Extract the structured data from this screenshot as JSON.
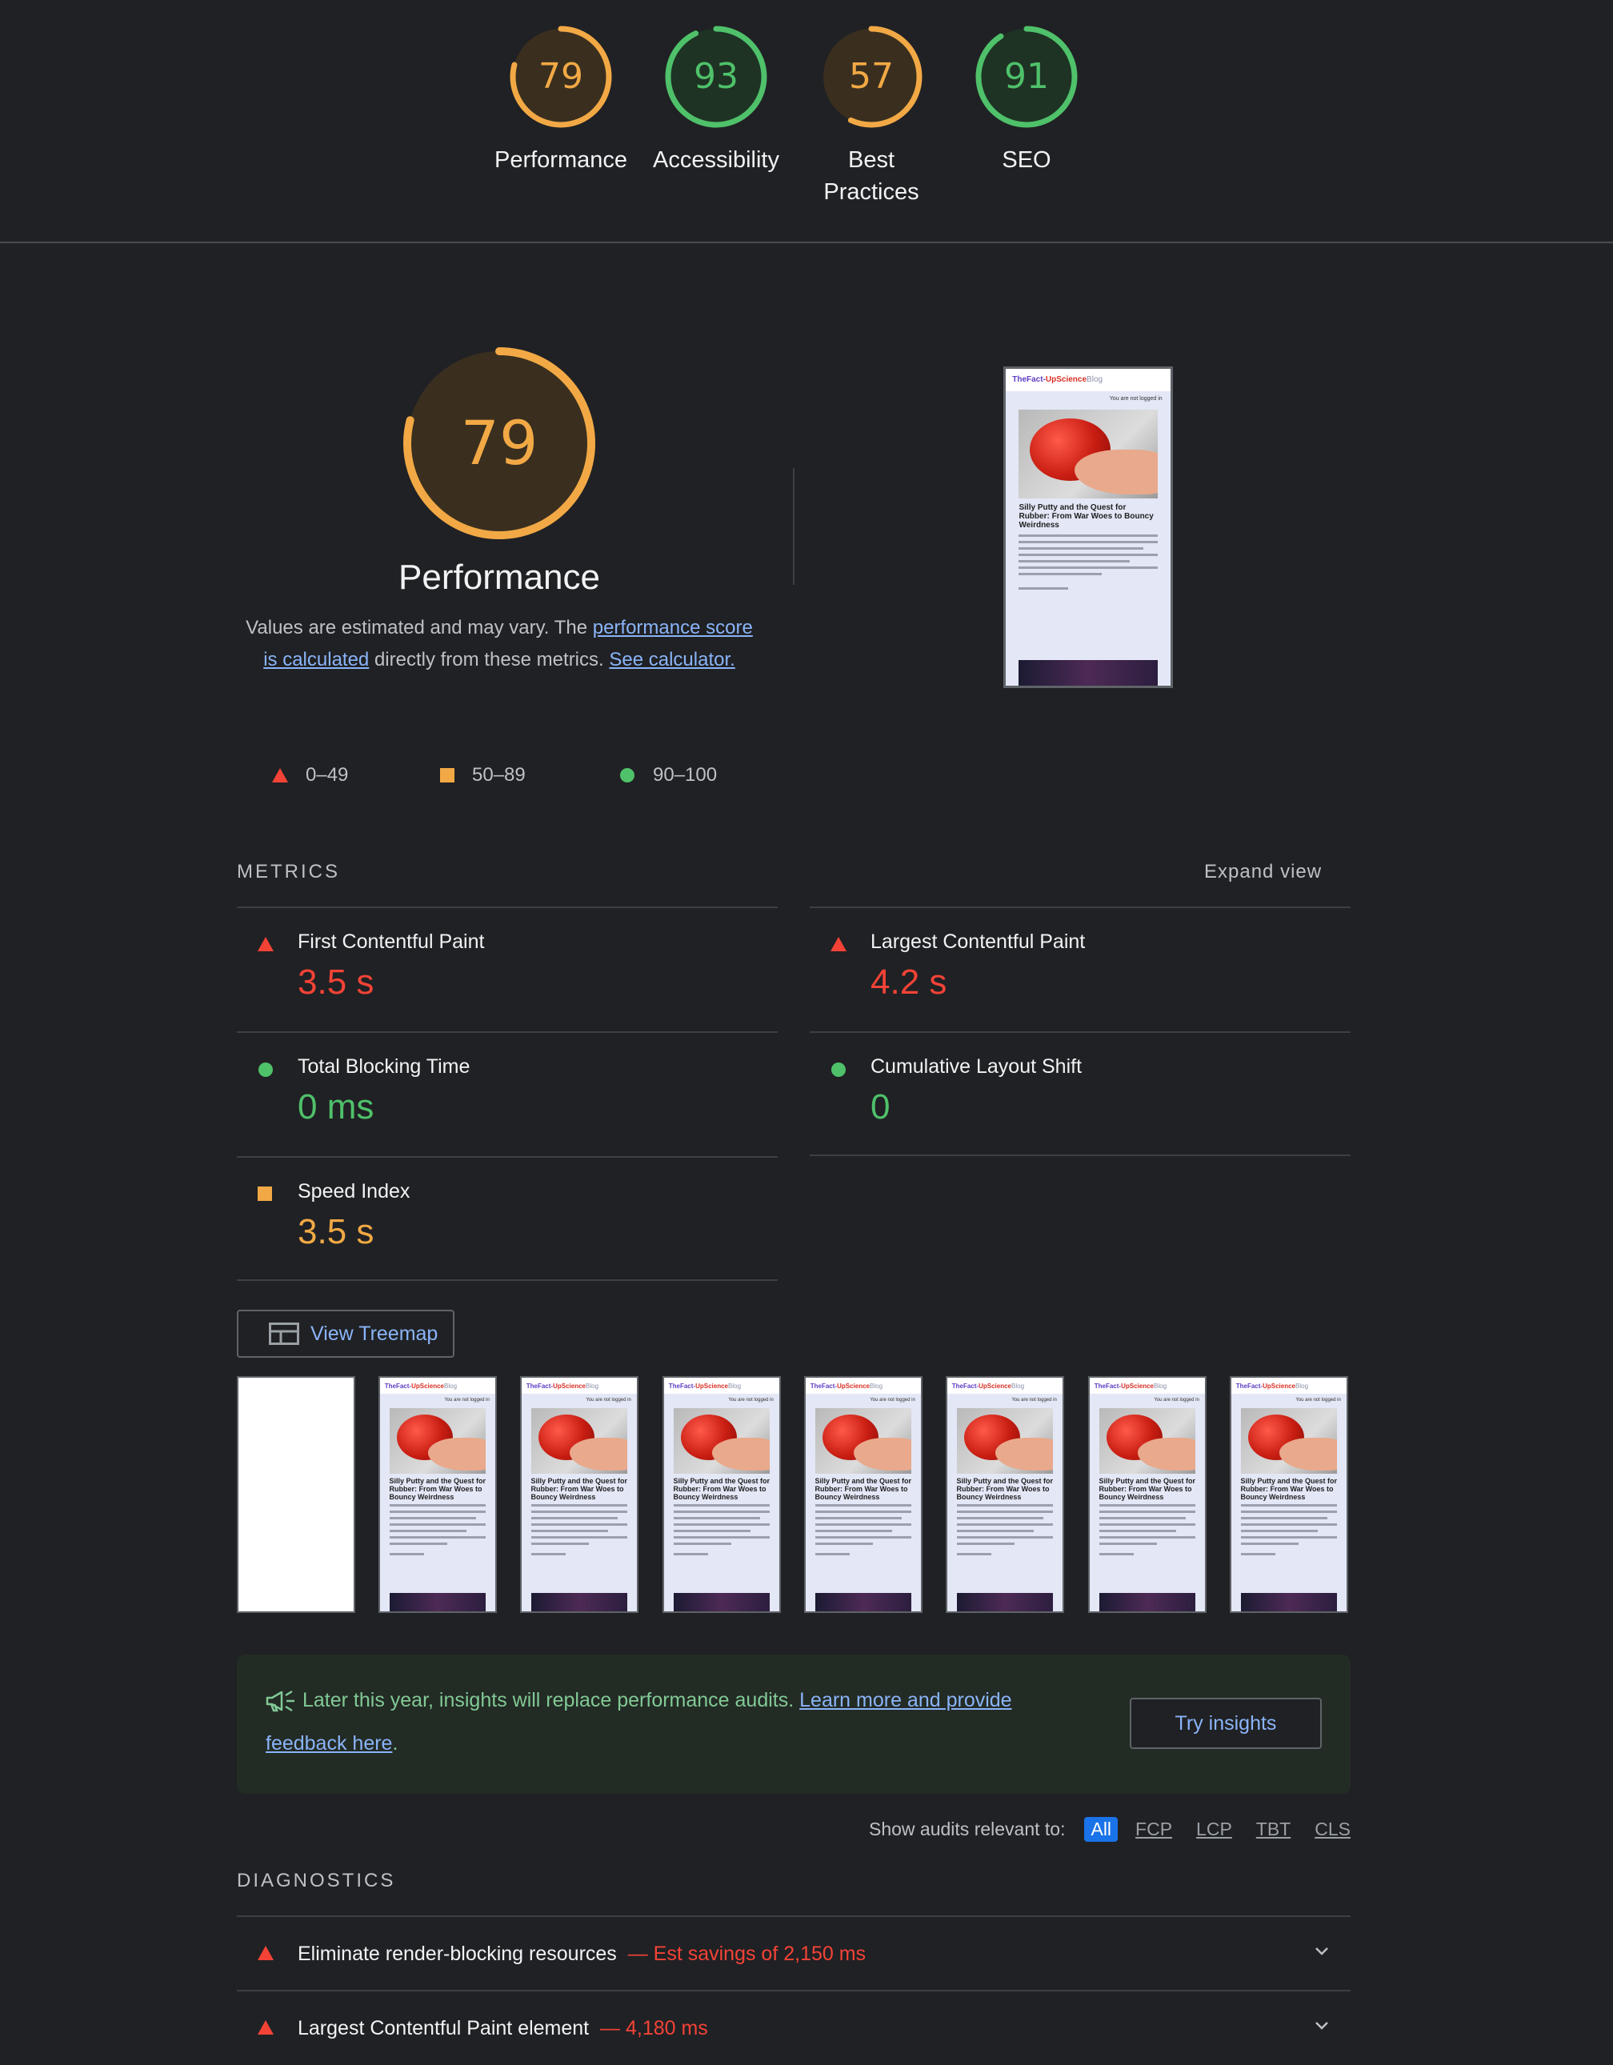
{
  "gauges": [
    {
      "score": "79",
      "label": "Performance",
      "color": "#f2a945",
      "fraction": 0.79
    },
    {
      "score": "93",
      "label": "Accessibility",
      "color": "#4fc16a",
      "fraction": 0.93
    },
    {
      "score": "57",
      "label": "Best Practices",
      "color": "#f2a945",
      "fraction": 0.57
    },
    {
      "score": "91",
      "label": "SEO",
      "color": "#4fc16a",
      "fraction": 0.91
    }
  ],
  "performance": {
    "score": "79",
    "fraction": 0.79,
    "title": "Performance",
    "desc_prefix": "Values are estimated and may vary. The ",
    "desc_link": "performance score is calculated",
    "desc_middle": " directly from these metrics. ",
    "desc_link2": "See calculator.",
    "legend": [
      {
        "range": "0–49",
        "shape": "triangle",
        "color": "#f44336"
      },
      {
        "range": "50–89",
        "shape": "square",
        "color": "#f2a945"
      },
      {
        "range": "90–100",
        "shape": "circle",
        "color": "#4fc16a"
      }
    ]
  },
  "screenshot": {
    "brand1": "TheFact-",
    "brand2": "UpScience",
    "brand3": "Blog",
    "not_logged": "You are not logged in",
    "post_title": "Silly Putty and the Quest for Rubber: From War Woes to Bouncy Weirdness"
  },
  "metrics": {
    "header": "METRICS",
    "expand": "Expand view",
    "items": [
      {
        "name": "First Contentful Paint",
        "value": "3.5 s",
        "status": "fail"
      },
      {
        "name": "Largest Contentful Paint",
        "value": "4.2 s",
        "status": "fail"
      },
      {
        "name": "Total Blocking Time",
        "value": "0 ms",
        "status": "pass"
      },
      {
        "name": "Cumulative Layout Shift",
        "value": "0",
        "status": "pass"
      },
      {
        "name": "Speed Index",
        "value": "3.5 s",
        "status": "average"
      }
    ]
  },
  "treemap_label": "View Treemap",
  "insights": {
    "message": "Later this year, insights will replace performance audits. ",
    "link": "Learn more and provide feedback here",
    "suffix": ".",
    "button": "Try insights"
  },
  "filter": {
    "label": "Show audits relevant to:",
    "chips": [
      "All",
      "FCP",
      "LCP",
      "TBT",
      "CLS"
    ]
  },
  "diagnostics": {
    "header": "DIAGNOSTICS",
    "items": [
      {
        "title": "Eliminate render-blocking resources",
        "savings": "— Est savings of 2,150 ms"
      },
      {
        "title": "Largest Contentful Paint element",
        "savings": "— 4,180 ms"
      }
    ]
  },
  "colors": {
    "fail": "#f44336",
    "average": "#f2a945",
    "pass": "#4fc16a",
    "link": "#8ab4f8"
  }
}
